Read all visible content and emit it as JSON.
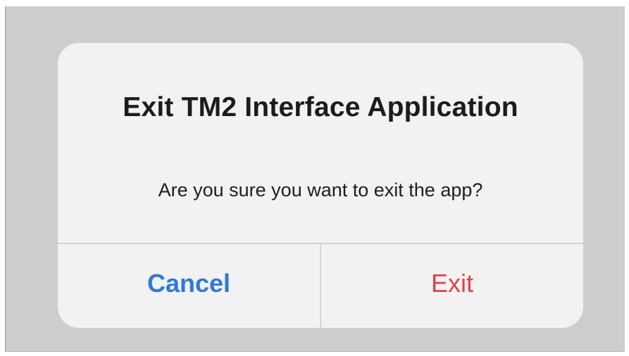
{
  "alert": {
    "title": "Exit TM2 Interface Application",
    "message": "Are you sure you want to exit the app?",
    "buttons": {
      "cancel_label": "Cancel",
      "exit_label": "Exit"
    }
  },
  "colors": {
    "backdrop": "#cdcdcd",
    "alert_background": "#f2f2f2",
    "cancel_text": "#2e7ad8",
    "exit_text": "#e0434a",
    "divider": "#d4d4d4"
  }
}
